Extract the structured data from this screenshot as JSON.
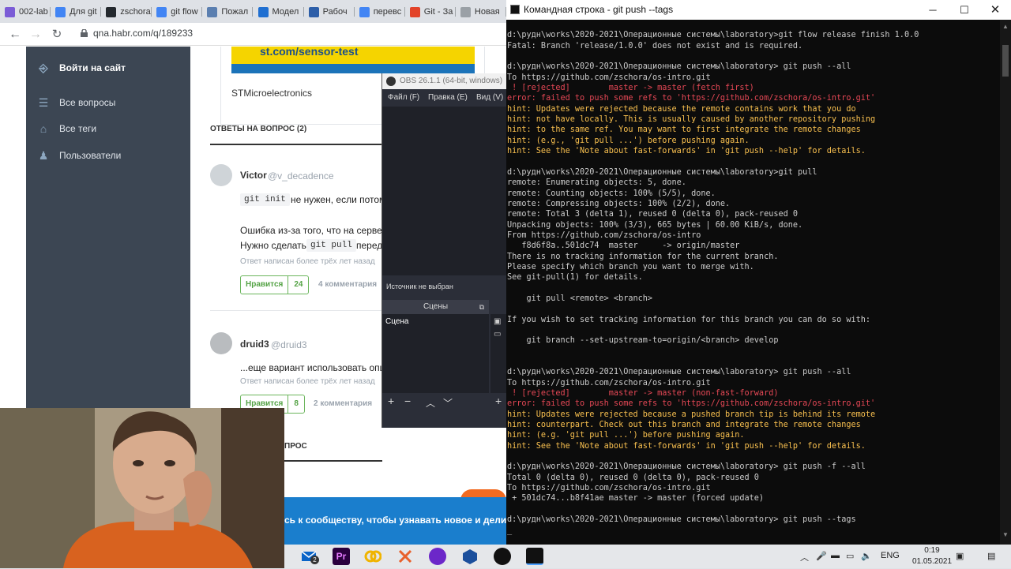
{
  "browser": {
    "tabs": [
      {
        "label": "002-lab",
        "color": "#7b5cd6"
      },
      {
        "label": "Для git",
        "color": "#4285f4"
      },
      {
        "label": "zschora",
        "color": "#24292e"
      },
      {
        "label": "git flow",
        "color": "#4285f4"
      },
      {
        "label": "Пожал",
        "color": "#5b7fb0"
      },
      {
        "label": "Модел",
        "color": "#1f6fd1"
      },
      {
        "label": "Рабоч",
        "color": "#2d5ea8"
      },
      {
        "label": "перевс",
        "color": "#4285f4"
      },
      {
        "label": "Git - За",
        "color": "#e24329"
      },
      {
        "label": "Новая",
        "color": "#9aa0a6"
      }
    ],
    "url": "qna.habr.com/q/189233",
    "sidebar": {
      "login": "Войти на сайт",
      "items": [
        "Все вопросы",
        "Все теги",
        "Пользователи"
      ]
    },
    "banner_text": "st.com/sensor-test",
    "sponsor": "STMicroelectronics",
    "answers_heading": "ОТВЕТЫ НА ВОПРОС (2)",
    "answer1": {
      "author": "Victor",
      "handle": "@v_decadence",
      "code1": "git init",
      "text1": "не нужен, если потом",
      "text2": "Ошибка из-за того, что на сервер",
      "text3": "Нужно сделать",
      "code2": "git pull",
      "text4": "перед",
      "meta": "Ответ написан более трёх лет назад",
      "like_label": "Нравится",
      "like_count": "24",
      "comments": "4 комментария"
    },
    "answer2": {
      "author": "druid3",
      "handle": "@druid3",
      "text1": "...еще вариант использовать опци",
      "meta": "Ответ написан более трёх лет назад",
      "like_label": "Нравится",
      "like_count": "8",
      "comments": "2 комментария"
    },
    "section_tail": "ПРОС",
    "join_text": "сь к сообществу, чтобы узнавать новое и делиться"
  },
  "obs": {
    "title": "OBS 26.1.1 (64-bit, windows)",
    "menu": [
      "Файл (F)",
      "Правка (E)",
      "Вид (V)"
    ],
    "source_none": "Источник не выбран",
    "scenes_label": "Сцены",
    "scene_item": "Сцена"
  },
  "terminal": {
    "title": "Командная строка - git  push --tags",
    "lines": [
      {
        "t": "",
        "c": ""
      },
      {
        "t": "d:\\рудн\\works\\2020-2021\\Операционные системы\\laboratory>git flow release finish 1.0.0",
        "c": ""
      },
      {
        "t": "Fatal: Branch 'release/1.0.0' does not exist and is required.",
        "c": ""
      },
      {
        "t": "",
        "c": ""
      },
      {
        "t": "d:\\рудн\\works\\2020-2021\\Операционные системы\\laboratory> git push --all",
        "c": ""
      },
      {
        "t": "To https://github.com/zschora/os-intro.git",
        "c": ""
      },
      {
        "t": " ! [rejected]        master -> master (fetch first)",
        "c": "red"
      },
      {
        "t": "error: failed to push some refs to 'https://github.com/zschora/os-intro.git'",
        "c": "red"
      },
      {
        "t": "hint: Updates were rejected because the remote contains work that you do",
        "c": "yel"
      },
      {
        "t": "hint: not have locally. This is usually caused by another repository pushing",
        "c": "yel"
      },
      {
        "t": "hint: to the same ref. You may want to first integrate the remote changes",
        "c": "yel"
      },
      {
        "t": "hint: (e.g., 'git pull ...') before pushing again.",
        "c": "yel"
      },
      {
        "t": "hint: See the 'Note about fast-forwards' in 'git push --help' for details.",
        "c": "yel"
      },
      {
        "t": "",
        "c": ""
      },
      {
        "t": "d:\\рудн\\works\\2020-2021\\Операционные системы\\laboratory>git pull",
        "c": ""
      },
      {
        "t": "remote: Enumerating objects: 5, done.",
        "c": ""
      },
      {
        "t": "remote: Counting objects: 100% (5/5), done.",
        "c": ""
      },
      {
        "t": "remote: Compressing objects: 100% (2/2), done.",
        "c": ""
      },
      {
        "t": "remote: Total 3 (delta 1), reused 0 (delta 0), pack-reused 0",
        "c": ""
      },
      {
        "t": "Unpacking objects: 100% (3/3), 665 bytes | 60.00 KiB/s, done.",
        "c": ""
      },
      {
        "t": "From https://github.com/zschora/os-intro",
        "c": ""
      },
      {
        "t": "   f8d6f8a..501dc74  master     -> origin/master",
        "c": ""
      },
      {
        "t": "There is no tracking information for the current branch.",
        "c": ""
      },
      {
        "t": "Please specify which branch you want to merge with.",
        "c": ""
      },
      {
        "t": "See git-pull(1) for details.",
        "c": ""
      },
      {
        "t": "",
        "c": ""
      },
      {
        "t": "    git pull <remote> <branch>",
        "c": ""
      },
      {
        "t": "",
        "c": ""
      },
      {
        "t": "If you wish to set tracking information for this branch you can do so with:",
        "c": ""
      },
      {
        "t": "",
        "c": ""
      },
      {
        "t": "    git branch --set-upstream-to=origin/<branch> develop",
        "c": ""
      },
      {
        "t": "",
        "c": ""
      },
      {
        "t": "",
        "c": ""
      },
      {
        "t": "d:\\рудн\\works\\2020-2021\\Операционные системы\\laboratory> git push --all",
        "c": ""
      },
      {
        "t": "To https://github.com/zschora/os-intro.git",
        "c": ""
      },
      {
        "t": " ! [rejected]        master -> master (non-fast-forward)",
        "c": "red"
      },
      {
        "t": "error: failed to push some refs to 'https://github.com/zschora/os-intro.git'",
        "c": "red"
      },
      {
        "t": "hint: Updates were rejected because a pushed branch tip is behind its remote",
        "c": "yel"
      },
      {
        "t": "hint: counterpart. Check out this branch and integrate the remote changes",
        "c": "yel"
      },
      {
        "t": "hint: (e.g. 'git pull ...') before pushing again.",
        "c": "yel"
      },
      {
        "t": "hint: See the 'Note about fast-forwards' in 'git push --help' for details.",
        "c": "yel"
      },
      {
        "t": "",
        "c": ""
      },
      {
        "t": "d:\\рудн\\works\\2020-2021\\Операционные системы\\laboratory> git push -f --all",
        "c": ""
      },
      {
        "t": "Total 0 (delta 0), reused 0 (delta 0), pack-reused 0",
        "c": ""
      },
      {
        "t": "To https://github.com/zschora/os-intro.git",
        "c": ""
      },
      {
        "t": " + 501dc74...b8f41ae master -> master (forced update)",
        "c": ""
      },
      {
        "t": "",
        "c": ""
      },
      {
        "t": "d:\\рудн\\works\\2020-2021\\Операционные системы\\laboratory> git push --tags",
        "c": ""
      },
      {
        "t": "_",
        "c": ""
      }
    ]
  },
  "taskbar": {
    "mail_badge": "2",
    "lang": "ENG",
    "time": "0:19",
    "date": "01.05.2021"
  }
}
